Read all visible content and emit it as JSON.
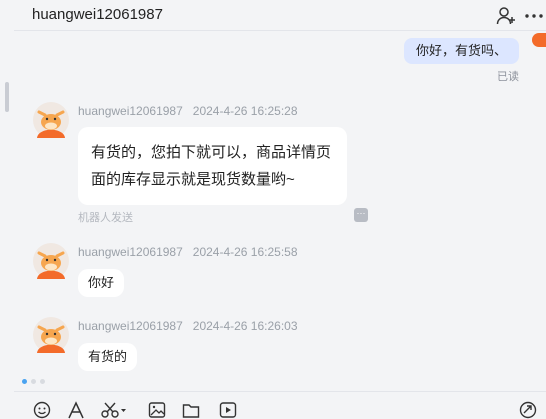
{
  "header": {
    "title": "huangwei12061987",
    "add_contact_icon": "add-user-icon",
    "more_icon": "more-horizontal-icon"
  },
  "messages": {
    "outgoing": {
      "text": "你好，有货吗、",
      "status": "已读"
    },
    "incoming": [
      {
        "sender": "huangwei12061987",
        "time": "2024-4-26 16:25:28",
        "text": "有货的，您拍下就可以，商品详情页面的库存显示就是现货数量哟~",
        "note": "机器人发送"
      },
      {
        "sender": "huangwei12061987",
        "time": "2024-4-26 16:25:58",
        "text": "你好"
      },
      {
        "sender": "huangwei12061987",
        "time": "2024-4-26 16:26:03",
        "text": "有货的"
      }
    ]
  },
  "toolbar": {
    "icons": [
      "emoji-icon",
      "font-icon",
      "scissors-icon",
      "image-icon",
      "folder-icon",
      "video-icon",
      "send-action-icon"
    ]
  },
  "colors": {
    "background": "#f3f4f6",
    "outgoing_bubble": "#dce6ff",
    "incoming_bubble": "#ffffff",
    "avatar_orange": "#f36b2a",
    "active_dot": "#4aa3f0"
  }
}
